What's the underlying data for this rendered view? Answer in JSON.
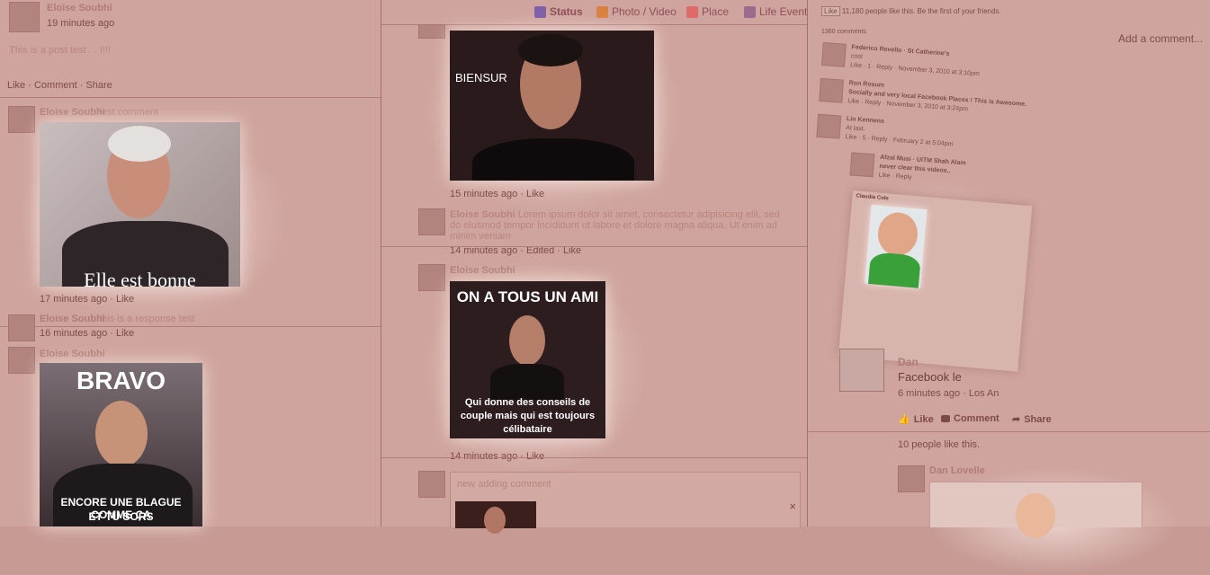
{
  "colors": {
    "background": "#c79a94",
    "panel": "#cfa49e",
    "text": "#6e3b3b",
    "link": "#8f4f59"
  },
  "left": {
    "status_post": {
      "author": "Eloise Soubhi",
      "time": "19 minutes ago",
      "text": "This is a post test . . !!!!"
    },
    "actions": {
      "like": "Like",
      "comment": "Comment",
      "share": "Share"
    },
    "comment1": {
      "author": "Eloise Soubhi",
      "text": "test comment",
      "caption": "Elle est bonne",
      "time": "17 minutes ago",
      "like": "Like"
    },
    "comment2": {
      "author": "Eloise Soubhi",
      "text": "this is a response test",
      "time": "16 minutes ago",
      "like": "Like"
    },
    "comment3": {
      "author": "Eloise Soubhi",
      "caption_top": "BRAVO",
      "caption_bottom_1": "ENCORE UNE BLAGUE COMME ÇA",
      "caption_bottom_2": "ET TU SORS"
    }
  },
  "middle": {
    "tabs": [
      {
        "label": "Status",
        "icon": "pencil-icon"
      },
      {
        "label": "Photo / Video",
        "icon": "photo-icon"
      },
      {
        "label": "Place",
        "icon": "place-pin-icon"
      },
      {
        "label": "Life Event",
        "icon": "flag-icon"
      }
    ],
    "image1": {
      "caption": "BIENSUR",
      "time": "15 minutes ago",
      "like": "Like"
    },
    "comment_lorem": {
      "author": "Eloise Soubhi",
      "text": "Lorem ipsum dolor sit amet, consectetur adipisicing elit, sed do eiusmod tempor incididunt ut labore et dolore magna aliqua. Ut enim ad minim veniam",
      "time": "14 minutes ago",
      "edited": "Edited",
      "like": "Like"
    },
    "image2": {
      "author": "Eloise Soubhi",
      "caption_top": "ON A TOUS UN AMI ...",
      "caption_bottom": "Qui donne des conseils de couple mais qui est toujours célibataire",
      "time": "14 minutes ago",
      "like": "Like"
    },
    "new_comment": {
      "text": "new adding comment",
      "close": "×"
    }
  },
  "right": {
    "like_box": {
      "like": "Like",
      "text": "11,180 people like this. Be the first of your friends."
    },
    "comments_count": "1360 comments",
    "add_comment": "Add a comment...",
    "comments": [
      {
        "author": "Federico Revello",
        "place": "St Catherine's",
        "text": "cool",
        "meta": "Like · 1 · Reply · November 3, 2010 at 3:10pm"
      },
      {
        "author": "Ron Rosum",
        "text": "Socially and very local Facebook Places ! This is Awesome.",
        "meta": "Like · Reply · November 3, 2010 at 3:24pm"
      },
      {
        "author": "Lin Kennens",
        "text": "At last.",
        "meta": "Like · 5 · Reply · February 2 at 5:04pm"
      },
      {
        "author": "Afzal Musi",
        "place": "UiTM Shah Alam",
        "text": "never clear this videos..",
        "meta": "Like · Reply"
      }
    ],
    "reply_author": "Claudia Cole",
    "post": {
      "author": "Dan",
      "text": "Facebook le",
      "time": "6 minutes ago · Los An"
    },
    "actions": {
      "like": "Like",
      "comment": "Comment",
      "share": "Share"
    },
    "likes": "10 people like this.",
    "commenter": "Dan Lovelle"
  }
}
